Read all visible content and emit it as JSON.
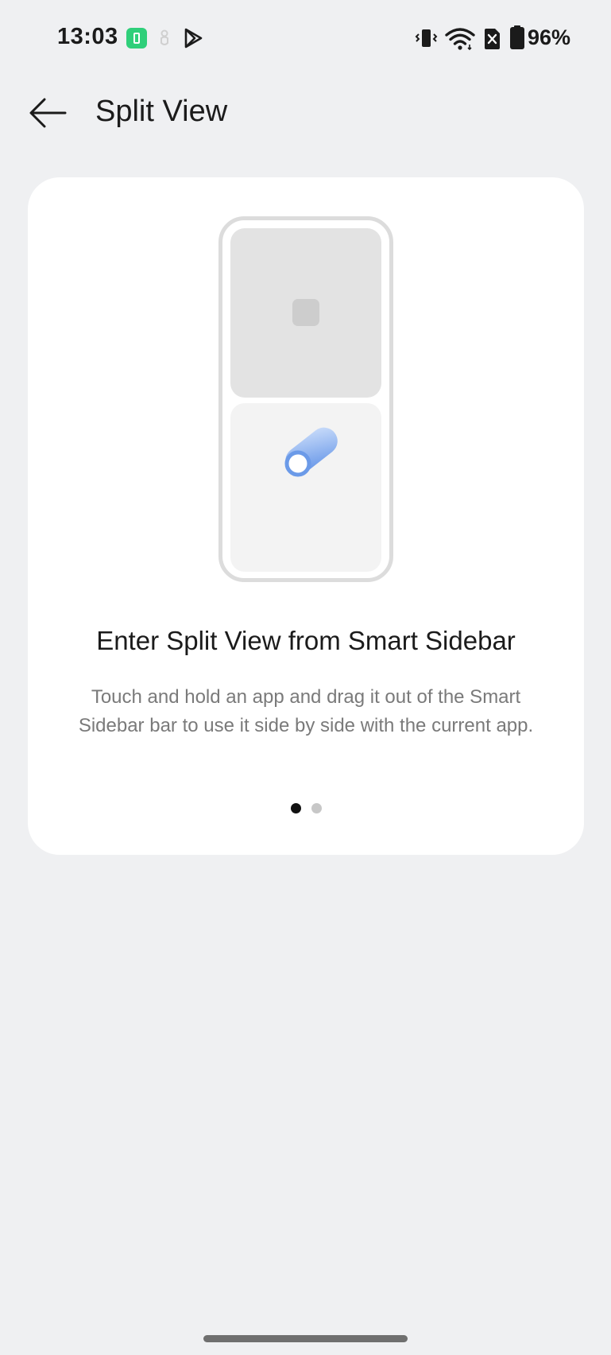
{
  "status_bar": {
    "time": "13:03",
    "battery_percent": "96%",
    "icons": [
      "battery-saver-icon",
      "touch-icon",
      "play-store-icon",
      "vibrate-icon",
      "wifi-icon",
      "no-sim-icon",
      "battery-icon"
    ]
  },
  "header": {
    "title": "Split View",
    "back_icon": "arrow-left-icon"
  },
  "card": {
    "heading": "Enter Split View from Smart Sidebar",
    "body": "Touch and hold an app and drag it out of the Smart Sidebar bar to use it side by side with the current app.",
    "pager": {
      "pages": 2,
      "current": 1
    }
  },
  "colors": {
    "background": "#eff0f2",
    "card": "#ffffff",
    "accent_blue": "#6b9ae8",
    "battery_saver_green": "#2fcf7a"
  }
}
